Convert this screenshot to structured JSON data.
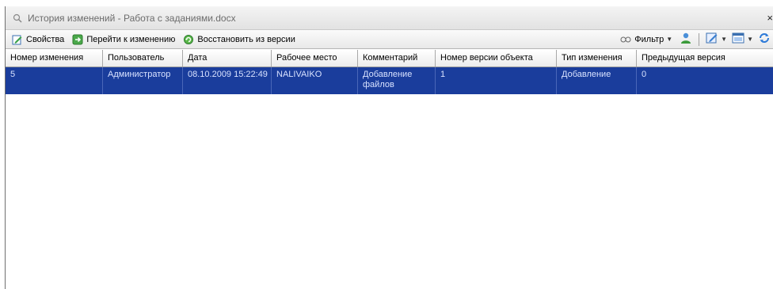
{
  "window": {
    "title": "История изменений - Работа с заданиями.docx",
    "close_glyph": "×"
  },
  "toolbar": {
    "properties": "Свойства",
    "go_to_change": "Перейти к изменению",
    "restore": "Восстановить из версии",
    "filter": "Фильтр"
  },
  "grid": {
    "columns": [
      "Номер изменения",
      "Пользователь",
      "Дата",
      "Рабочее место",
      "Комментарий",
      "Номер версии объекта",
      "Тип изменения",
      "Предыдущая версия"
    ],
    "rows": [
      {
        "number": "5",
        "user": "Администратор",
        "date": "08.10.2009 15:22:49",
        "workstation": "NALIVAIKO",
        "comment": "Добавление файлов",
        "version": "1",
        "change_type": "Добавление",
        "previous": "0"
      }
    ],
    "selected_row_color": "#1a3d9c"
  }
}
